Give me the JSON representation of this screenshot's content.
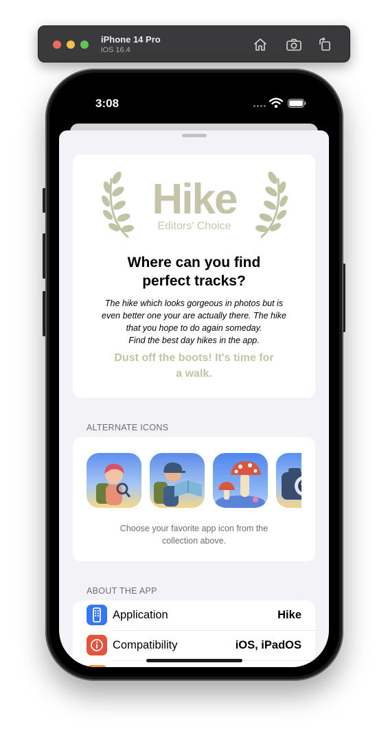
{
  "simulator": {
    "device_name": "iPhone 14 Pro",
    "os_version": "iOS 16.4",
    "toolbar_icons": [
      "home-icon",
      "screenshot-icon",
      "rotate-icon"
    ]
  },
  "status_bar": {
    "time": "3:08",
    "icons": [
      "signal-icon",
      "wifi-icon",
      "battery-icon"
    ]
  },
  "hero": {
    "logo_title": "Hike",
    "logo_subtitle": "Editors' Choice",
    "title_line1": "Where can you find",
    "title_line2": "perfect tracks?",
    "description_line1": "The hike which looks gorgeous in photos but is",
    "description_line2": "even better one your are actually there. The hike",
    "description_line3": "that you hope to do again someday.",
    "description_line4": "Find the best day hikes in the app.",
    "cta_line1": "Dust off the boots! It's time for",
    "cta_line2": "a walk.",
    "colors": {
      "accent": "#c3c4aa",
      "laurel": "#c0c3a4"
    }
  },
  "alternate_icons": {
    "header": "ALTERNATE ICONS",
    "icons": [
      "hiker-magnifier-icon",
      "hiker-map-icon",
      "mushroom-icon",
      "camera-icon"
    ],
    "caption_line1": "Choose your favorite app icon from the",
    "caption_line2": "collection above."
  },
  "about": {
    "header": "ABOUT THE APP",
    "rows": [
      {
        "icon": "apps-iphone-icon",
        "color": "#3478f6",
        "label": "Application",
        "value": "Hike"
      },
      {
        "icon": "info-circle-icon",
        "color": "#e5533d",
        "label": "Compatibility",
        "value": "iOS, iPadOS"
      },
      {
        "icon": "row-icon",
        "color": "#f19a37",
        "label": "",
        "value": ""
      }
    ]
  }
}
